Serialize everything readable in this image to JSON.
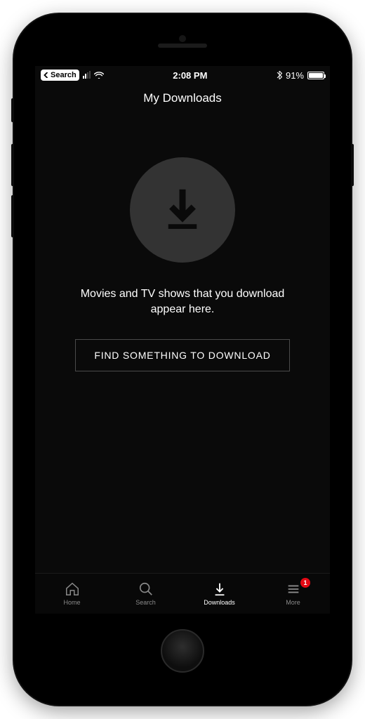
{
  "status": {
    "back_label": "Search",
    "time": "2:08 PM",
    "battery_pct": "91%"
  },
  "header": {
    "title": "My Downloads"
  },
  "empty_state": {
    "message": "Movies and TV shows that you download appear here.",
    "cta_label": "FIND SOMETHING TO DOWNLOAD"
  },
  "tabs": {
    "home": "Home",
    "search": "Search",
    "downloads": "Downloads",
    "more": "More",
    "more_badge": "1"
  }
}
